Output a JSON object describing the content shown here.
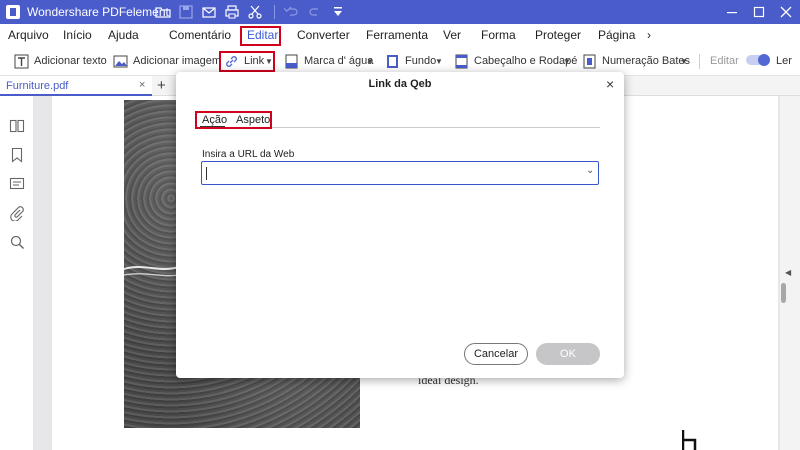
{
  "app": {
    "title": "Wondershare PDFelement"
  },
  "menu": {
    "items": [
      "Arquivo",
      "Início",
      "Ajuda",
      "Comentário",
      "Editar",
      "Converter",
      "Ferramenta",
      "Ver",
      "Forma",
      "Proteger",
      "Página"
    ],
    "active": "Editar",
    "more_glyph": "›"
  },
  "toolbar": {
    "add_text": "Adicionar texto",
    "add_image": "Adicionar imagem",
    "link": "Link",
    "watermark": "Marca d' água",
    "background": "Fundo",
    "header_footer": "Cabeçalho e Rodapé",
    "bates": "Numeração Bates",
    "edit": "Editar",
    "read": "Ler"
  },
  "tabs": {
    "file": "Furniture.pdf",
    "close": "×",
    "add": "+"
  },
  "document": {
    "visible_text": "ideal design."
  },
  "dialog": {
    "title": "Link da Qeb",
    "close": "×",
    "tab_action": "Ação",
    "tab_appearance": "Aspeto",
    "url_label": "Insira a URL da Web",
    "url_value": "",
    "cancel": "Cancelar",
    "ok": "OK"
  },
  "colors": {
    "accent": "#4a5cc9",
    "highlight": "#d0011b"
  }
}
